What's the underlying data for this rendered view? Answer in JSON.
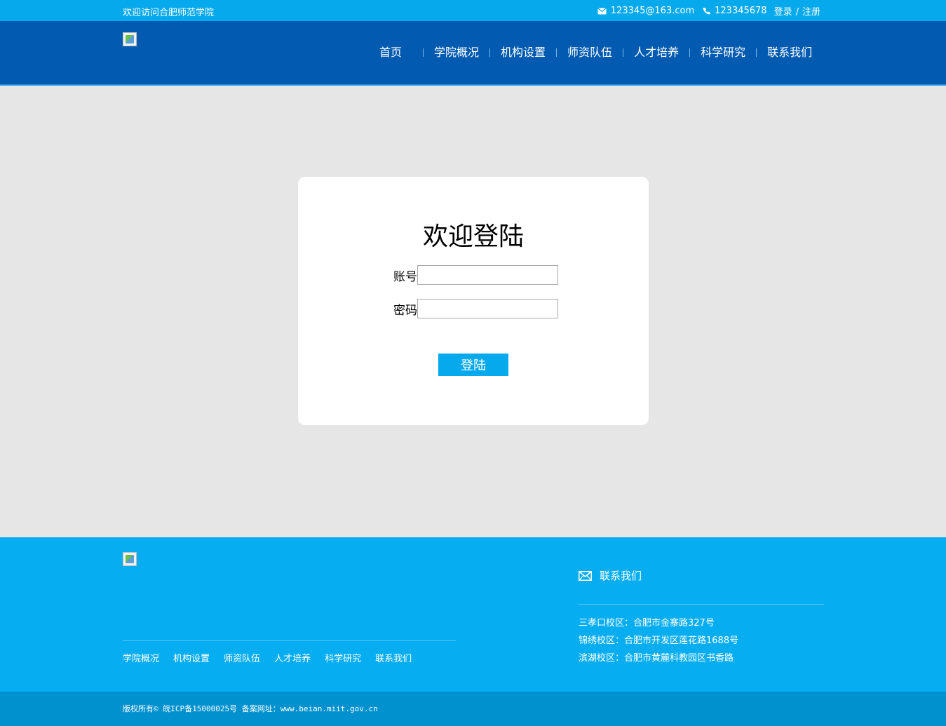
{
  "topbar": {
    "welcome": "欢迎访问合肥师范学院",
    "email": "123345@163.com",
    "phone": "123345678",
    "login": "登录",
    "sep": "/",
    "register": "注册"
  },
  "nav": {
    "items": [
      "首页",
      "学院概况",
      "机构设置",
      "师资队伍",
      "人才培养",
      "科学研究",
      "联系我们"
    ]
  },
  "login": {
    "title": "欢迎登陆",
    "account_label": "账号",
    "account_value": "",
    "password_label": "密码",
    "password_value": "",
    "button": "登陆"
  },
  "footer": {
    "links": [
      "学院概况",
      "机构设置",
      "师资队伍",
      "人才培养",
      "科学研究",
      "联系我们"
    ],
    "contact_title": "联系我们",
    "addresses": [
      "三孝口校区：合肥市金寨路327号",
      "锦绣校区：合肥市开发区莲花路1688号",
      "滨湖校区：合肥市黄麓科教园区书香路"
    ],
    "copyright": "版权所有© 皖ICP备15000025号 备案网址：www.beian.miit.gov.cn"
  },
  "icons": {
    "email": "mail-icon",
    "phone": "phone-icon",
    "contact": "mail-icon"
  },
  "colors": {
    "topbar": "#07a9ed",
    "header": "#025bb0",
    "footer": "#07adf1",
    "bottombar": "#0291cf",
    "button": "#07a9ed"
  }
}
